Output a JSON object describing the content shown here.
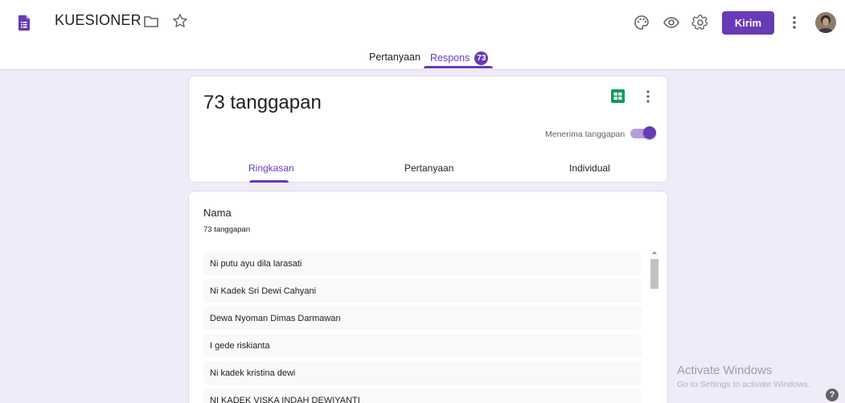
{
  "app": {
    "title": "KUESIONER",
    "send_label": "Kirim"
  },
  "icons": {
    "forms": "google-forms-icon",
    "folder": "folder-icon",
    "star": "star-icon",
    "palette": "palette-icon",
    "preview": "eye-icon",
    "settings": "gear-icon",
    "more": "more-vert-icon",
    "sheets": "google-sheets-icon",
    "help": "help-icon"
  },
  "main_tabs": [
    {
      "label": "Pertanyaan",
      "active": false
    },
    {
      "label": "Respons",
      "active": true,
      "badge": "73"
    }
  ],
  "responses": {
    "count_title": "73 tanggapan",
    "accepting_label": "Menerima tanggapan",
    "accepting": true,
    "sub_tabs": [
      {
        "label": "Ringkasan",
        "active": true
      },
      {
        "label": "Pertanyaan",
        "active": false
      },
      {
        "label": "Individual",
        "active": false
      }
    ]
  },
  "question": {
    "title": "Nama",
    "count": "73 tanggapan",
    "answers": [
      "Ni putu ayu dila larasati",
      "Ni Kadek Sri Dewi Cahyani",
      "Dewa Nyoman Dimas Darmawan",
      "I gede riskianta",
      "Ni kadek kristina dewi",
      "NI KADEK VISKA INDAH DEWIYANTI"
    ]
  },
  "watermark": {
    "title": "Activate Windows",
    "subtitle": "Go to Settings to activate Windows."
  },
  "help_glyph": "?",
  "colors": {
    "accent": "#673ab7",
    "background": "#f0ebf8",
    "sheets_green": "#0f9d58"
  }
}
